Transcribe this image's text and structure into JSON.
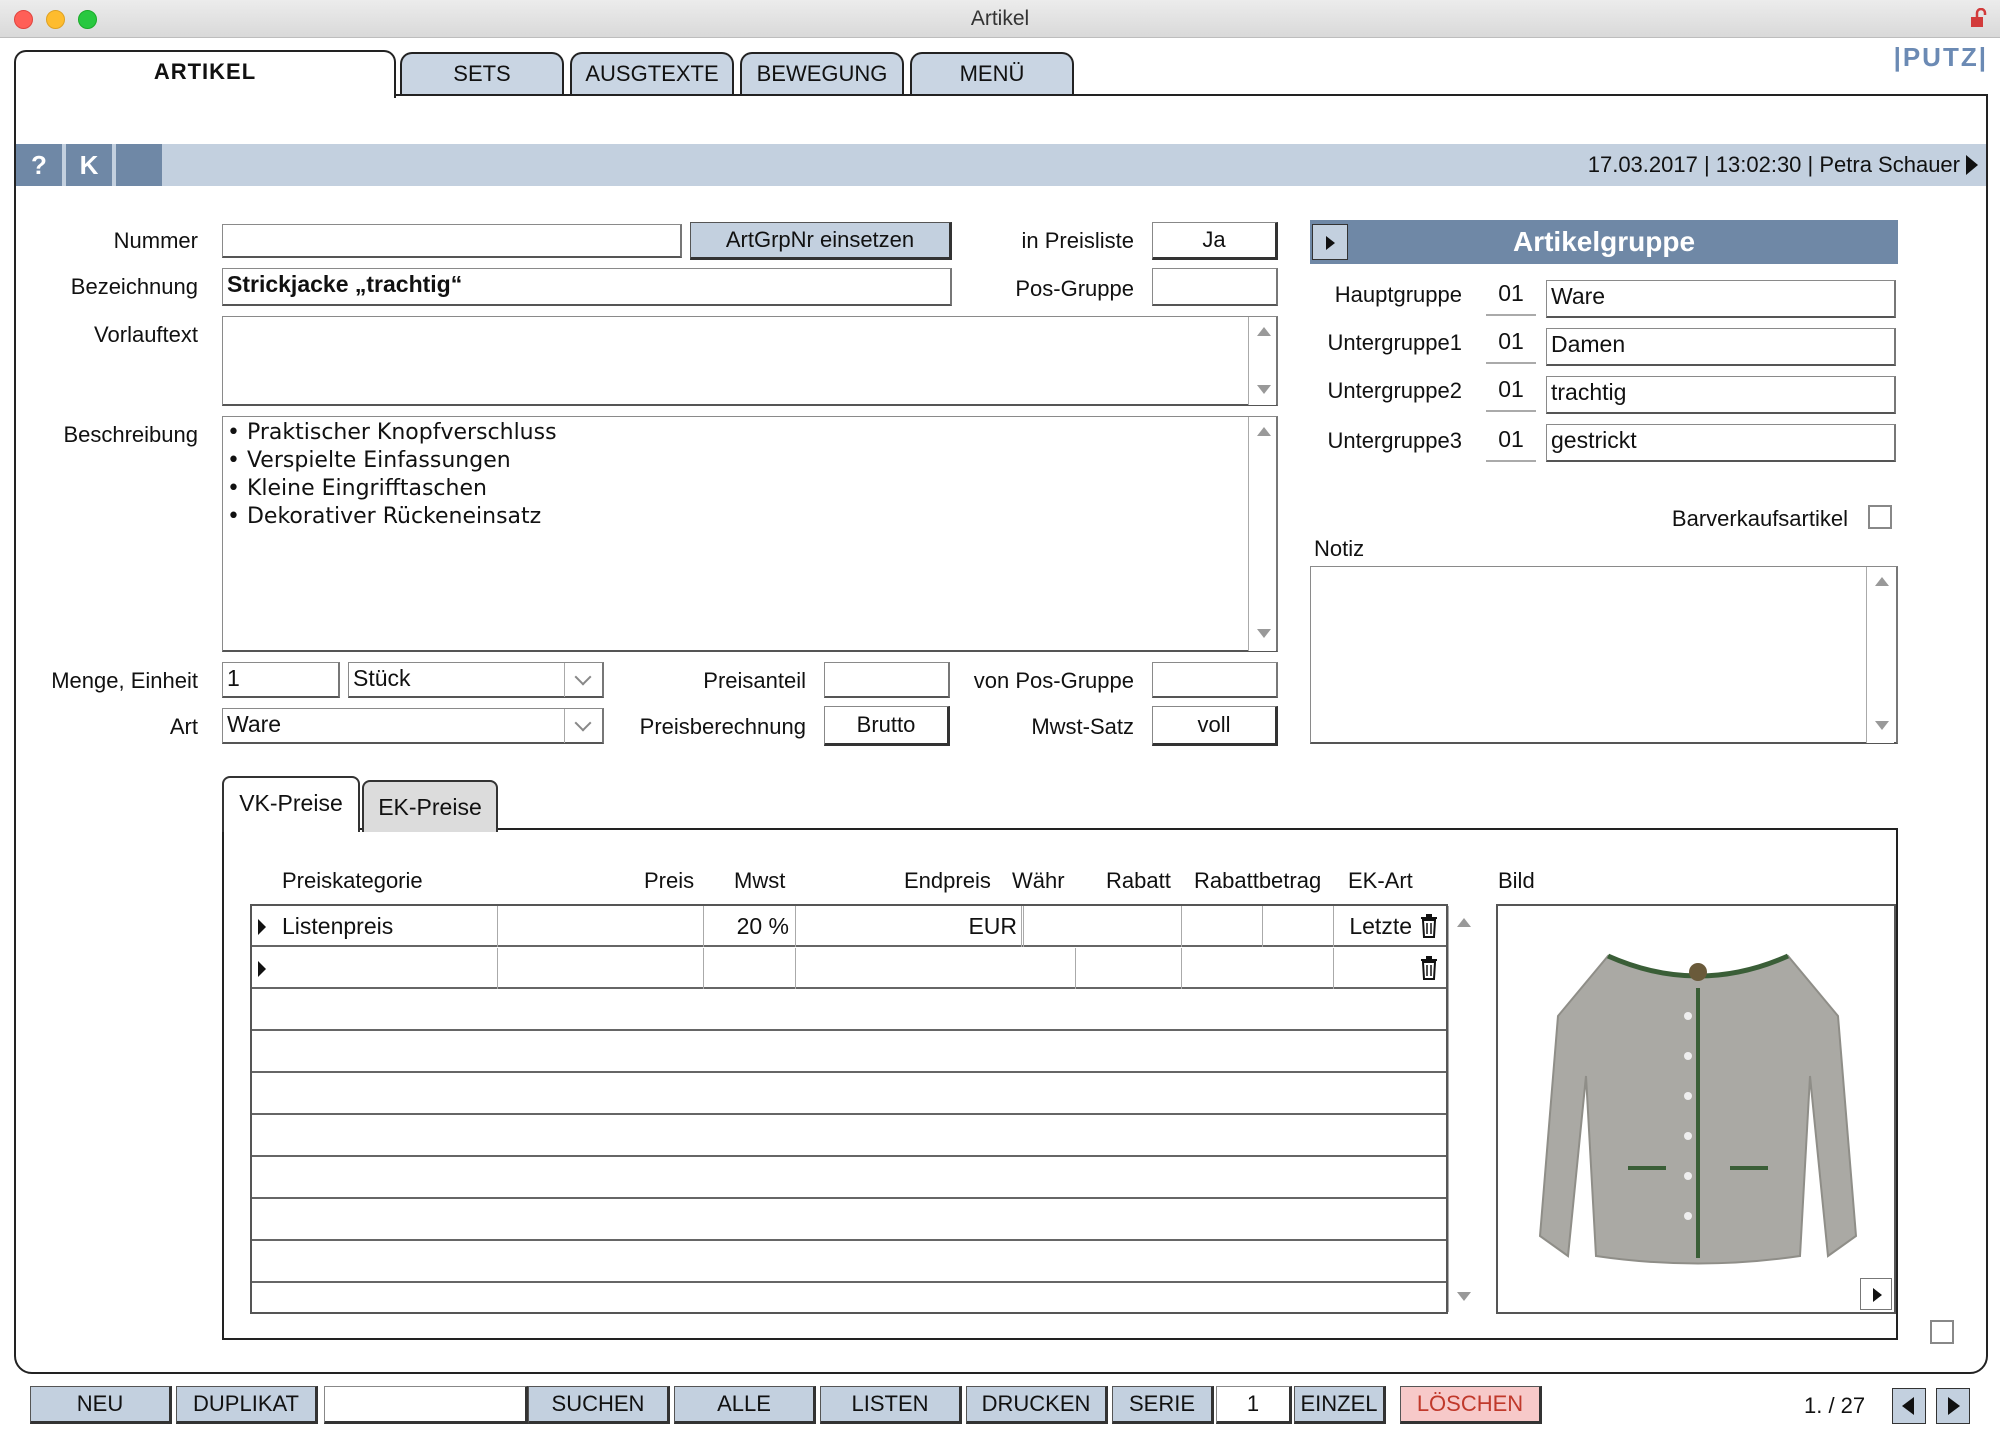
{
  "window": {
    "title": "Artikel"
  },
  "tabs": [
    "ARTIKEL",
    "SETS",
    "AUSGTEXTE",
    "BEWEGUNG",
    "MENÜ"
  ],
  "logo": "|PUTZ|",
  "infobar": {
    "help_label": "?",
    "k_label": "K",
    "datetime": "17.03.2017 | 13:02:30 | Petra Schauer"
  },
  "form": {
    "nummer_label": "Nummer",
    "nummer_value": "",
    "artgrp_button": "ArtGrpNr einsetzen",
    "bezeichnung_label": "Bezeichnung",
    "bezeichnung_value": "Strickjacke „trachtig“",
    "vorlauftext_label": "Vorlauftext",
    "vorlauftext_value": "",
    "beschreibung_label": "Beschreibung",
    "beschreibung_lines": [
      "• Praktischer Knopfverschluss",
      "• Verspielte Einfassungen",
      "• Kleine Eingrifftaschen",
      "• Dekorativer Rückeneinsatz"
    ],
    "preisliste_label": "in Preisliste",
    "preisliste_value": "Ja",
    "posgruppe_label": "Pos-Gruppe",
    "posgruppe_value": "",
    "menge_label": "Menge, Einheit",
    "menge_value": "1",
    "einheit_value": "Stück",
    "art_label": "Art",
    "art_value": "Ware",
    "preisanteil_label": "Preisanteil",
    "preisanteil_value": "",
    "preisberechnung_label": "Preisberechnung",
    "preisberechnung_value": "Brutto",
    "vonposgruppe_label": "von Pos-Gruppe",
    "vonposgruppe_value": "",
    "mwstsatz_label": "Mwst-Satz",
    "mwstsatz_value": "voll"
  },
  "artikelgruppe": {
    "title": "Artikelgruppe",
    "rows": [
      {
        "label": "Hauptgruppe",
        "code": "01",
        "value": "Ware"
      },
      {
        "label": "Untergruppe1",
        "code": "01",
        "value": "Damen"
      },
      {
        "label": "Untergruppe2",
        "code": "01",
        "value": "trachtig"
      },
      {
        "label": "Untergruppe3",
        "code": "01",
        "value": "gestrickt"
      }
    ],
    "barverkauf_label": "Barverkaufsartikel",
    "notiz_label": "Notiz"
  },
  "prices": {
    "subtabs": [
      "VK-Preise",
      "EK-Preise"
    ],
    "columns": {
      "preiskategorie": "Preiskategorie",
      "preis": "Preis",
      "mwst": "Mwst",
      "endpreis": "Endpreis",
      "waehr": "Währ",
      "rabatt": "Rabatt",
      "rabattbetrag": "Rabattbetrag",
      "ekart": "EK-Art",
      "bild": "Bild"
    },
    "row1": {
      "kategorie": "Listenpreis",
      "preis": "",
      "mwst": "20 %",
      "endpreis": "",
      "waehr": "EUR",
      "rabatt": "",
      "rabattbetrag": "",
      "ekart": "Letzte"
    }
  },
  "toolbar": {
    "neu": "NEU",
    "duplikat": "DUPLIKAT",
    "search_value": "",
    "suchen": "SUCHEN",
    "alle": "ALLE",
    "listen": "LISTEN",
    "drucken": "DRUCKEN",
    "serie": "SERIE",
    "serie_value": "1",
    "einzel": "EINZEL",
    "loeschen": "LÖSCHEN",
    "record_counter": "1. / 27"
  },
  "colors": {
    "accent": "#6f88a6",
    "tab_bg": "#c9d5e3",
    "infobar_bg": "#c3d0df",
    "delete_bg": "#f7c9c9"
  }
}
